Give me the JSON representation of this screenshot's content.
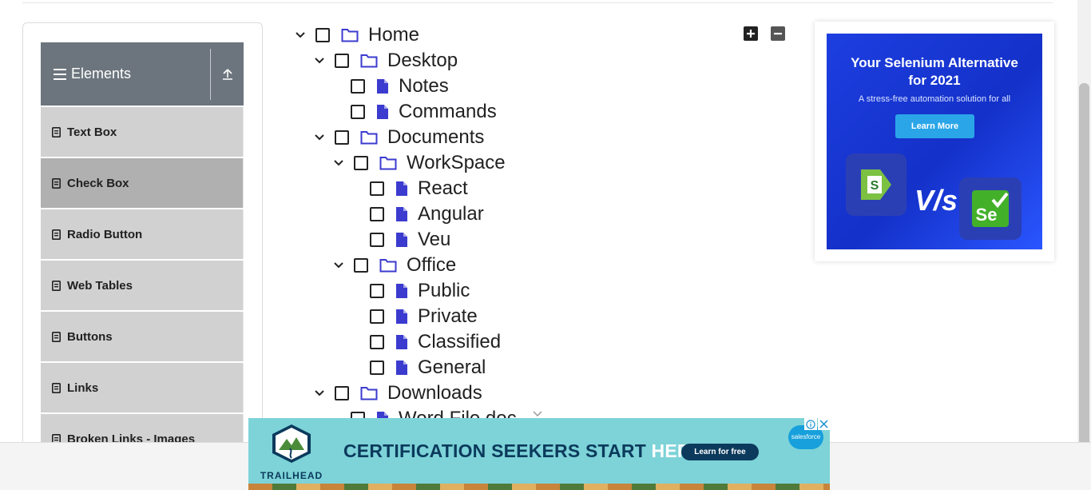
{
  "sidebar": {
    "group_title": "Elements",
    "items": [
      {
        "label": "Text Box",
        "active": false
      },
      {
        "label": "Check Box",
        "active": true
      },
      {
        "label": "Radio Button",
        "active": false
      },
      {
        "label": "Web Tables",
        "active": false
      },
      {
        "label": "Buttons",
        "active": false
      },
      {
        "label": "Links",
        "active": false
      },
      {
        "label": "Broken Links - Images",
        "active": false
      }
    ]
  },
  "tree": {
    "nodes": [
      {
        "label": "Home",
        "type": "folder",
        "expanded": true,
        "checked": false,
        "depth": 0
      },
      {
        "label": "Desktop",
        "type": "folder",
        "expanded": true,
        "checked": false,
        "depth": 1
      },
      {
        "label": "Notes",
        "type": "file",
        "checked": false,
        "depth": 2
      },
      {
        "label": "Commands",
        "type": "file",
        "checked": false,
        "depth": 2
      },
      {
        "label": "Documents",
        "type": "folder",
        "expanded": true,
        "checked": false,
        "depth": 1
      },
      {
        "label": "WorkSpace",
        "type": "folder",
        "expanded": true,
        "checked": false,
        "depth": 2
      },
      {
        "label": "React",
        "type": "file",
        "checked": false,
        "depth": 3
      },
      {
        "label": "Angular",
        "type": "file",
        "checked": false,
        "depth": 3
      },
      {
        "label": "Veu",
        "type": "file",
        "checked": false,
        "depth": 3
      },
      {
        "label": "Office",
        "type": "folder",
        "expanded": true,
        "checked": false,
        "depth": 2
      },
      {
        "label": "Public",
        "type": "file",
        "checked": false,
        "depth": 3
      },
      {
        "label": "Private",
        "type": "file",
        "checked": false,
        "depth": 3
      },
      {
        "label": "Classified",
        "type": "file",
        "checked": false,
        "depth": 3
      },
      {
        "label": "General",
        "type": "file",
        "checked": false,
        "depth": 3
      },
      {
        "label": "Downloads",
        "type": "folder",
        "expanded": true,
        "checked": false,
        "depth": 1
      },
      {
        "label": "Word File.doc",
        "type": "file",
        "checked": false,
        "depth": 2
      }
    ],
    "controls": {
      "expand_all": "plus-icon",
      "collapse_all": "minus-icon"
    }
  },
  "ad_right": {
    "headline_line1": "Your Selenium Alternative",
    "headline_line2": "for 2021",
    "subtext": "A stress-free automation solution for all",
    "cta": "Learn More",
    "vs": "V/s"
  },
  "ad_bottom": {
    "brand": "TRAILHEAD",
    "headline_main": "CERTIFICATION SEEKERS START ",
    "headline_accent": "HERE.",
    "cta": "Learn for free",
    "partner": "salesforce"
  },
  "colors": {
    "accent": "#3b3bcf",
    "sidebar_header": "#6c757d",
    "menu_item": "#d1d1d1",
    "menu_item_active": "#b0b0b0"
  }
}
